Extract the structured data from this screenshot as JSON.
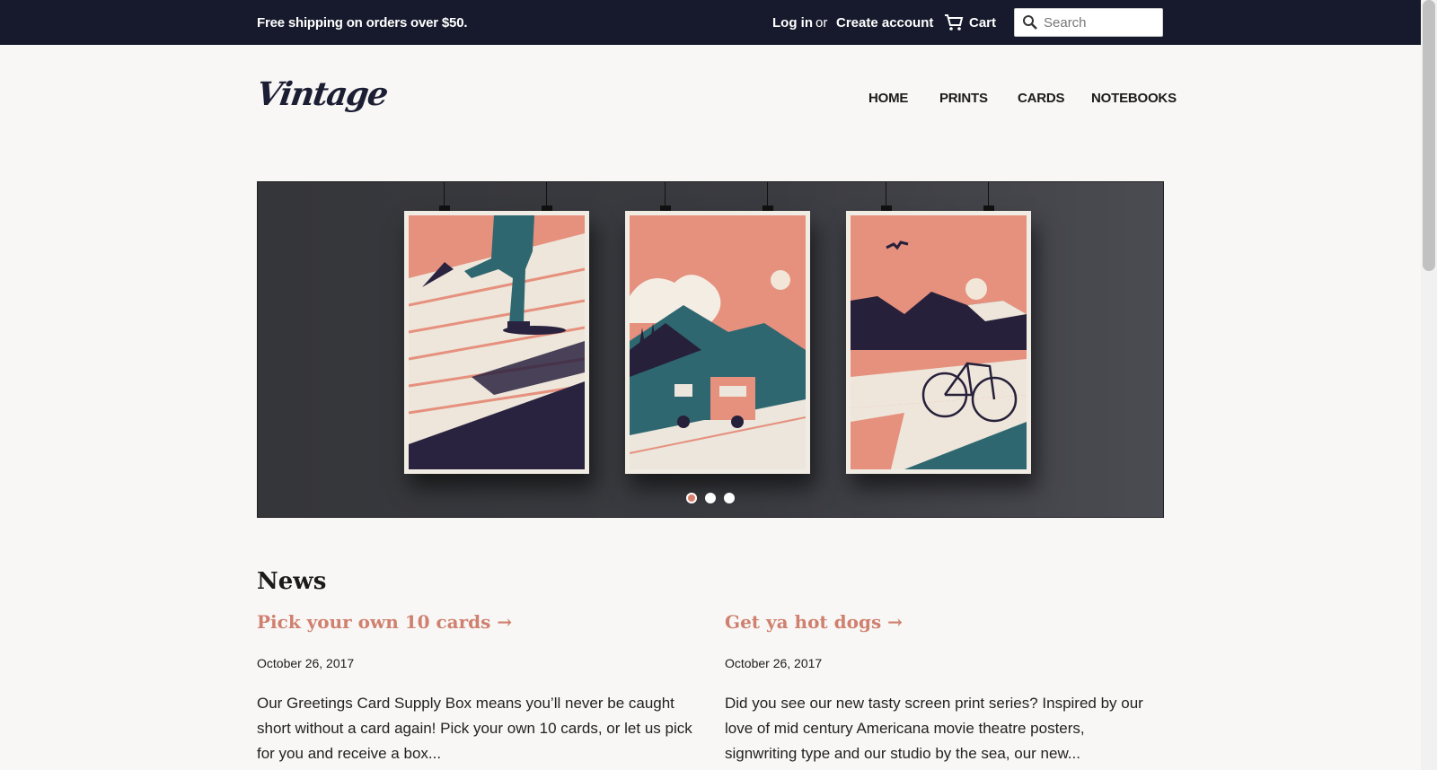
{
  "topbar": {
    "promo": "Free shipping on orders over $50.",
    "login": "Log in",
    "or": "or",
    "create_account": "Create account",
    "cart": "Cart",
    "search_placeholder": "Search"
  },
  "header": {
    "logo": "Vintage",
    "nav": [
      "HOME",
      "PRINTS",
      "CARDS",
      "NOTEBOOKS"
    ]
  },
  "slideshow": {
    "slide_count": 3,
    "active_index": 0
  },
  "news": {
    "heading": "News",
    "posts": [
      {
        "title": "Pick your own 10 cards →",
        "date": "October 26, 2017",
        "excerpt": "Our Greetings Card Supply Box means you’ll never be caught short without a card again! Pick your own 10 cards, or let us pick for you and receive a box..."
      },
      {
        "title": "Get ya hot dogs →",
        "date": "October 26, 2017",
        "excerpt": "Did you see our new tasty screen print series? Inspired by our love of mid century Americana movie theatre posters, signwriting type and our studio by the sea, our new..."
      }
    ]
  },
  "colors": {
    "topbar": "#161a2c",
    "accent": "#d0806e",
    "page_bg": "#f8f7f6"
  }
}
